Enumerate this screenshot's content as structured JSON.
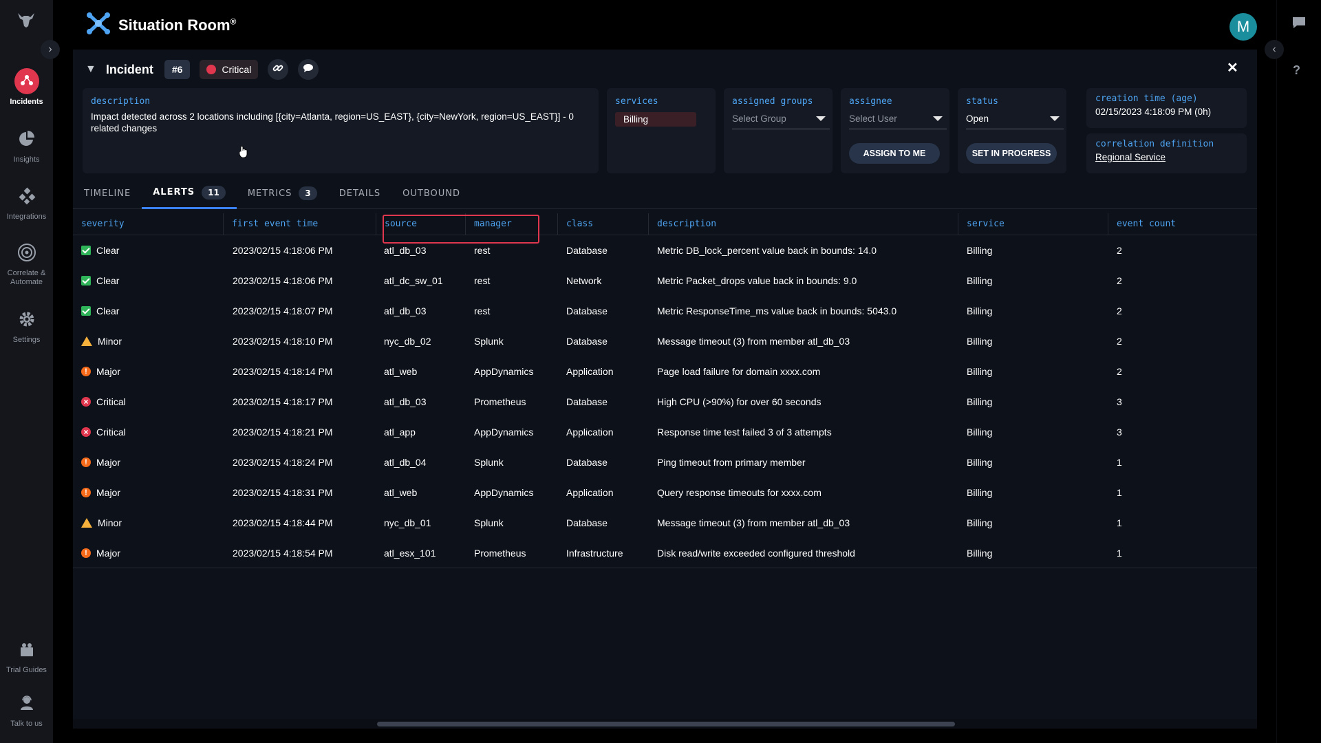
{
  "app": {
    "title": "Situation Room",
    "title_mark": "®",
    "user_initial": "M"
  },
  "nav": {
    "items": [
      {
        "label": "Incidents",
        "icon": "incidents-icon",
        "active": true
      },
      {
        "label": "Insights",
        "icon": "pie-chart-icon"
      },
      {
        "label": "Integrations",
        "icon": "integrations-icon"
      },
      {
        "label": "Correlate & Automate",
        "icon": "target-icon"
      },
      {
        "label": "Settings",
        "icon": "gear-icon"
      }
    ],
    "bottom": [
      {
        "label": "Trial Guides",
        "icon": "guides-icon"
      },
      {
        "label": "Talk to us",
        "icon": "support-agent-icon"
      }
    ]
  },
  "incident": {
    "title": "Incident",
    "number": "#6",
    "severity": "Critical",
    "description_label": "description",
    "description": "Impact detected across 2 locations including [{city=Atlanta, region=US_EAST}, {city=NewYork, region=US_EAST}] - 0 related changes",
    "services_label": "services",
    "service": "Billing",
    "groups_label": "assigned groups",
    "groups_placeholder": "Select Group",
    "assignee_label": "assignee",
    "assignee_placeholder": "Select User",
    "assign_btn": "ASSIGN TO ME",
    "status_label": "status",
    "status_value": "Open",
    "progress_btn": "SET IN PROGRESS",
    "creation_label": "creation time (age)",
    "creation_value": "02/15/2023 4:18:09 PM (0h)",
    "correlation_label": "correlation definition",
    "correlation_value": "Regional Service"
  },
  "tabs": [
    {
      "label": "TIMELINE",
      "count": ""
    },
    {
      "label": "ALERTS",
      "count": "11",
      "active": true
    },
    {
      "label": "METRICS",
      "count": "3"
    },
    {
      "label": "DETAILS",
      "count": ""
    },
    {
      "label": "OUTBOUND",
      "count": ""
    }
  ],
  "table": {
    "headers": {
      "severity": "severity",
      "time": "first event time",
      "source": "source",
      "manager": "manager",
      "class": "class",
      "description": "description",
      "service": "service",
      "count": "event count"
    },
    "rows": [
      {
        "severity": "Clear",
        "time": "2023/02/15 4:18:06 PM",
        "source": "atl_db_03",
        "manager": "rest",
        "class": "Database",
        "description": "Metric DB_lock_percent value back in bounds: 14.0",
        "service": "Billing",
        "count": "2"
      },
      {
        "severity": "Clear",
        "time": "2023/02/15 4:18:06 PM",
        "source": "atl_dc_sw_01",
        "manager": "rest",
        "class": "Network",
        "description": "Metric Packet_drops value back in bounds: 9.0",
        "service": "Billing",
        "count": "2"
      },
      {
        "severity": "Clear",
        "time": "2023/02/15 4:18:07 PM",
        "source": "atl_db_03",
        "manager": "rest",
        "class": "Database",
        "description": "Metric ResponseTime_ms value back in bounds: 5043.0",
        "service": "Billing",
        "count": "2"
      },
      {
        "severity": "Minor",
        "time": "2023/02/15 4:18:10 PM",
        "source": "nyc_db_02",
        "manager": "Splunk",
        "class": "Database",
        "description": "Message timeout (3) from member atl_db_03",
        "service": "Billing",
        "count": "2"
      },
      {
        "severity": "Major",
        "time": "2023/02/15 4:18:14 PM",
        "source": "atl_web",
        "manager": "AppDynamics",
        "class": "Application",
        "description": "Page load failure for domain xxxx.com",
        "service": "Billing",
        "count": "2"
      },
      {
        "severity": "Critical",
        "time": "2023/02/15 4:18:17 PM",
        "source": "atl_db_03",
        "manager": "Prometheus",
        "class": "Database",
        "description": "High CPU (>90%) for over 60 seconds",
        "service": "Billing",
        "count": "3"
      },
      {
        "severity": "Critical",
        "time": "2023/02/15 4:18:21 PM",
        "source": "atl_app",
        "manager": "AppDynamics",
        "class": "Application",
        "description": "Response time test failed 3 of 3 attempts",
        "service": "Billing",
        "count": "3"
      },
      {
        "severity": "Major",
        "time": "2023/02/15 4:18:24 PM",
        "source": "atl_db_04",
        "manager": "Splunk",
        "class": "Database",
        "description": "Ping timeout from primary member",
        "service": "Billing",
        "count": "1"
      },
      {
        "severity": "Major",
        "time": "2023/02/15 4:18:31 PM",
        "source": "atl_web",
        "manager": "AppDynamics",
        "class": "Application",
        "description": "Query response timeouts for xxxx.com",
        "service": "Billing",
        "count": "1"
      },
      {
        "severity": "Minor",
        "time": "2023/02/15 4:18:44 PM",
        "source": "nyc_db_01",
        "manager": "Splunk",
        "class": "Database",
        "description": "Message timeout (3) from member atl_db_03",
        "service": "Billing",
        "count": "1"
      },
      {
        "severity": "Major",
        "time": "2023/02/15 4:18:54 PM",
        "source": "atl_esx_101",
        "manager": "Prometheus",
        "class": "Infrastructure",
        "description": "Disk read/write exceeded configured threshold",
        "service": "Billing",
        "count": "1"
      }
    ]
  },
  "colors": {
    "accent": "#3b82f6",
    "critical": "#e0374e",
    "major": "#f56b1a",
    "minor": "#f6b13d",
    "clear": "#2fb45a",
    "label": "#4ea4f2"
  }
}
